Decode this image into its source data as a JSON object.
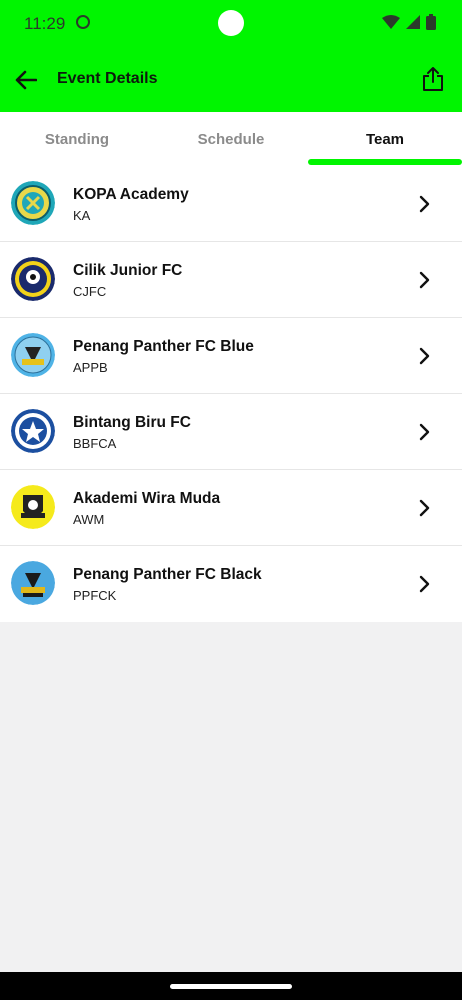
{
  "status_bar": {
    "time": "11:29"
  },
  "app_bar": {
    "title": "Event Details",
    "accent_color": "#00f500"
  },
  "tabs": [
    {
      "label": "Standing",
      "active": false
    },
    {
      "label": "Schedule",
      "active": false
    },
    {
      "label": "Team",
      "active": true
    }
  ],
  "teams": [
    {
      "name": "KOPA Academy",
      "code": "KA",
      "logo_icon": "kopa-academy-logo-icon"
    },
    {
      "name": "Cilik Junior FC",
      "code": "CJFC",
      "logo_icon": "cilik-junior-logo-icon"
    },
    {
      "name": "Penang Panther FC Blue",
      "code": "APPB",
      "logo_icon": "penang-panther-blue-logo-icon"
    },
    {
      "name": "Bintang Biru FC",
      "code": "BBFCA",
      "logo_icon": "bintang-biru-logo-icon"
    },
    {
      "name": "Akademi Wira Muda",
      "code": "AWM",
      "logo_icon": "akademi-wira-muda-logo-icon"
    },
    {
      "name": "Penang Panther FC Black",
      "code": "PPFCK",
      "logo_icon": "penang-panther-black-logo-icon"
    }
  ]
}
